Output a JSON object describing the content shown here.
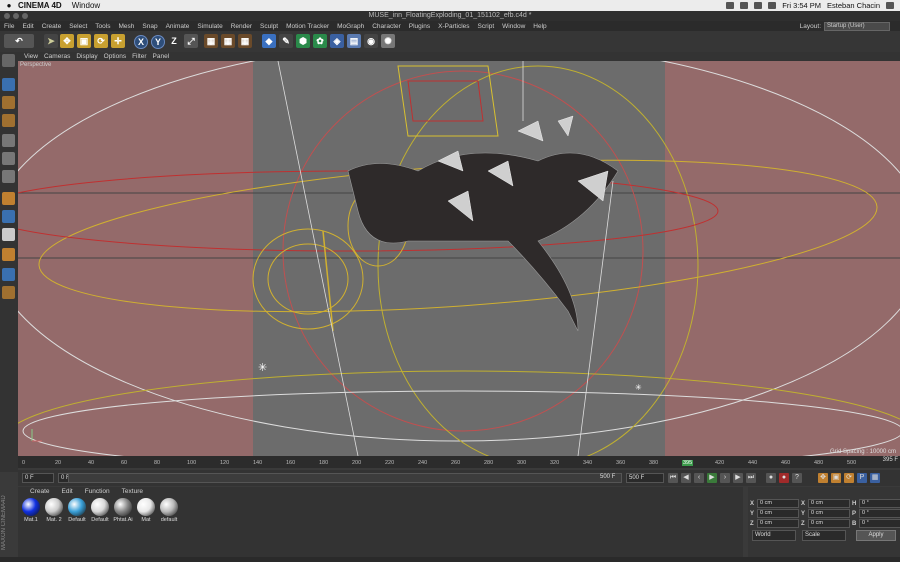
{
  "macbar": {
    "app": "CINEMA 4D",
    "menus": [
      "Window"
    ],
    "clock": "Fri 3:54 PM",
    "user": "Esteban Chacin"
  },
  "title": "MUSE_inn_FloatingExploding_01_151102_efb.c4d *",
  "c4d_menu": [
    "File",
    "Edit",
    "Create",
    "Select",
    "Tools",
    "Mesh",
    "Snap",
    "Animate",
    "Simulate",
    "Render",
    "Sculpt",
    "Motion Tracker",
    "MoGraph",
    "Character",
    "Plugins",
    "X-Particles",
    "Script",
    "Window",
    "Help"
  ],
  "layout": {
    "label": "Layout:",
    "value": "Startup (User)"
  },
  "axis_buttons": [
    "X",
    "Y",
    "Z"
  ],
  "view_menu": [
    "View",
    "Cameras",
    "Display",
    "Options",
    "Filter",
    "Panel"
  ],
  "viewport": {
    "label": "Perspective",
    "grid_spacing": "Grid Spacing : 10000 cm"
  },
  "timeline": {
    "ticks": [
      "0",
      "20",
      "40",
      "60",
      "80",
      "100",
      "120",
      "140",
      "160",
      "180",
      "200",
      "220",
      "240",
      "260",
      "280",
      "300",
      "320",
      "340",
      "360",
      "380",
      "395",
      "420",
      "440",
      "460",
      "480",
      "500"
    ],
    "current": "395",
    "end_field": "395 F"
  },
  "transport": {
    "start": "0 F",
    "current_field": "0 F",
    "end_a": "500 F",
    "end_b": "500 F"
  },
  "materials_menu": [
    "Create",
    "Edit",
    "Function",
    "Texture"
  ],
  "materials": [
    {
      "name": "Mat.1",
      "color": "#1030e0"
    },
    {
      "name": "Mat. 2",
      "color": "#cccccc"
    },
    {
      "name": "Default",
      "color": "#3aa0d8"
    },
    {
      "name": "Default",
      "color": "#d8d8d8"
    },
    {
      "name": "Phtat.Ai",
      "color": "#888888"
    },
    {
      "name": "Mat",
      "color": "#e8e8e8"
    },
    {
      "name": "default",
      "color": "#bbbbbb"
    }
  ],
  "attributes": {
    "rows": [
      {
        "a": "X",
        "v1": "0 cm",
        "b": "X",
        "v2": "0 cm",
        "c": "H",
        "v3": "0 °"
      },
      {
        "a": "Y",
        "v1": "0 cm",
        "b": "Y",
        "v2": "0 cm",
        "c": "P",
        "v3": "0 °"
      },
      {
        "a": "Z",
        "v1": "0 cm",
        "b": "Z",
        "v2": "0 cm",
        "c": "B",
        "v3": "0 °"
      }
    ],
    "world": "World",
    "scale": "Scale",
    "apply": "Apply"
  },
  "maxon": "MAXON CINEMA4D"
}
